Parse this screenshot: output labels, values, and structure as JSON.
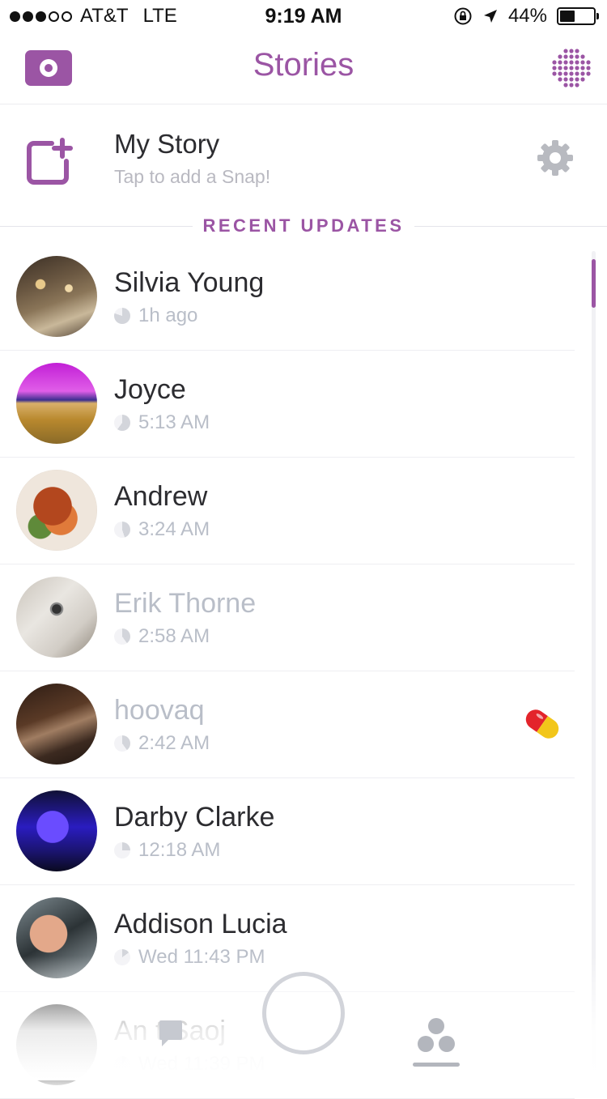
{
  "status_bar": {
    "carrier": "AT&T",
    "network": "LTE",
    "time": "9:19 AM",
    "battery": "44%",
    "battery_level": 0.44
  },
  "header": {
    "title": "Stories",
    "camera_icon": "camera-icon",
    "discover_icon": "discover-icon"
  },
  "my_story": {
    "title": "My Story",
    "hint": "Tap to add a Snap!",
    "add_icon": "add-story-icon",
    "settings_icon": "gear-icon"
  },
  "section": {
    "label": "RECENT UPDATES"
  },
  "stories": [
    {
      "name": "Silvia Young",
      "time": "1h ago",
      "viewed": false,
      "progress": 0.2
    },
    {
      "name": "Joyce",
      "time": "5:13 AM",
      "viewed": false,
      "progress": 0.4
    },
    {
      "name": "Andrew",
      "time": "3:24 AM",
      "viewed": false,
      "progress": 0.55
    },
    {
      "name": "Erik Thorne",
      "time": "2:58 AM",
      "viewed": true,
      "progress": 0.6
    },
    {
      "name": "hoovaq",
      "time": "2:42 AM",
      "viewed": true,
      "progress": 0.6,
      "emoji": "pill"
    },
    {
      "name": "Darby Clarke",
      "time": "12:18 AM",
      "viewed": false,
      "progress": 0.75
    },
    {
      "name": "Addison Lucia",
      "time": "Wed 11:43 PM",
      "viewed": false,
      "progress": 0.85
    },
    {
      "name": "An  t Saoj",
      "time": "Wed 11:39 PM",
      "viewed": false,
      "progress": 0.9
    }
  ],
  "colors": {
    "accent": "#9b55a4",
    "viewed_text": "#b9bec8"
  }
}
